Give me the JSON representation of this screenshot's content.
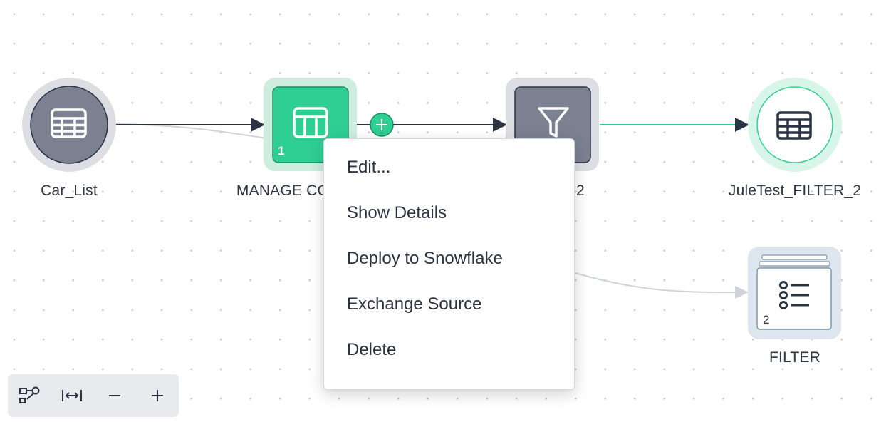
{
  "nodes": {
    "car_list": {
      "label": "Car_List"
    },
    "manage": {
      "label": "MANAGE CO",
      "badge": "1"
    },
    "filter2_partial": {
      "label": "2"
    },
    "jule": {
      "label": "JuleTest_FILTER_2"
    },
    "filter": {
      "label": "FILTER",
      "badge": "2"
    }
  },
  "context_menu": {
    "items": [
      {
        "label": "Edit..."
      },
      {
        "label": "Show Details"
      },
      {
        "label": "Deploy to Snowflake"
      },
      {
        "label": "Exchange Source"
      },
      {
        "label": "Delete"
      }
    ]
  },
  "toolbar": {
    "buttons": [
      "lineage-icon",
      "fit-width-icon",
      "zoom-out-icon",
      "zoom-in-icon"
    ]
  },
  "colors": {
    "accent_green": "#2fcf94",
    "node_gray": "#7c8192",
    "edge_dark": "#2b3442",
    "panel_bg": "#e8eaee"
  }
}
